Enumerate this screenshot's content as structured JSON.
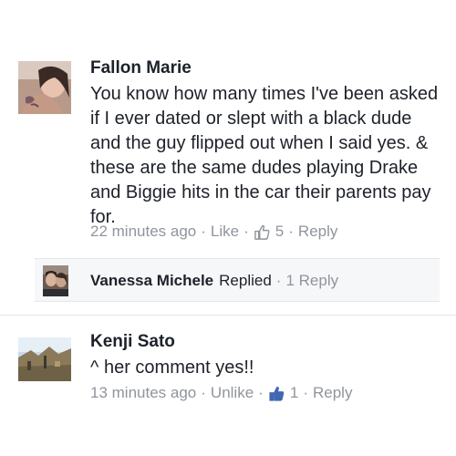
{
  "comments": [
    {
      "author": "Fallon Marie",
      "text": "You know how many times I've been asked if I ever dated or slept with a black dude and the guy flipped out when I said yes. & these are the same dudes playing Drake and Biggie hits in the car their parents pay for.",
      "time": "22 minutes ago",
      "action": "Like",
      "likes": "5",
      "reply_label": "Reply",
      "separator": "·"
    },
    {
      "author": "Kenji Sato",
      "text": "^ her comment yes!!",
      "time": "13 minutes ago",
      "action": "Unlike",
      "likes": "1",
      "reply_label": "Reply",
      "separator": "·"
    }
  ],
  "reply_summary": {
    "author": "Vanessa Michele",
    "verb": "Replied",
    "separator": "·",
    "count_label": "1 Reply"
  },
  "colors": {
    "text": "#1d2129",
    "meta": "#90949c",
    "like_blue": "#4267b2",
    "reply_bg": "#f6f7f9"
  },
  "icons": {
    "avatar_1": "profile-photo",
    "avatar_reply": "profile-photo",
    "avatar_2": "profile-photo",
    "like": "thumbs-up-icon"
  }
}
